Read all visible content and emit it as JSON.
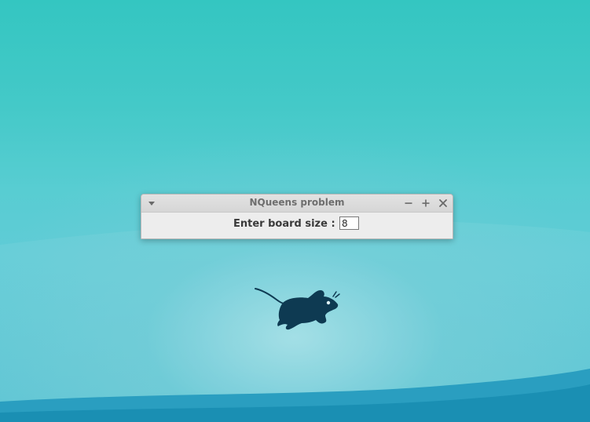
{
  "window": {
    "title": "NQueens problem"
  },
  "form": {
    "board_size_label": "Enter board size :",
    "board_size_value": "8"
  },
  "icons": {
    "menu": "chevron-down-icon",
    "minimize": "minimize-icon",
    "maximize": "maximize-icon",
    "close": "close-icon",
    "desktop_logo": "xfce-mouse-logo"
  },
  "colors": {
    "desktop_top": "#34c6c1",
    "desktop_bottom_wave": "#1a8fb3",
    "window_bg": "#ededed",
    "mouse_logo": "#0e3a52"
  }
}
